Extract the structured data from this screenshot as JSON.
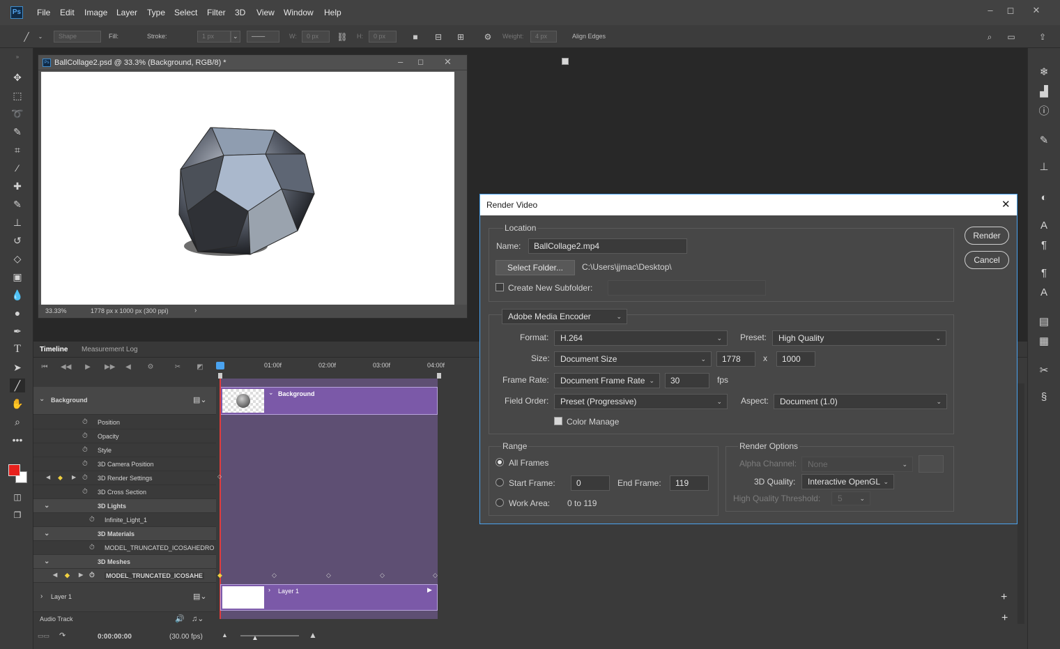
{
  "menubar": {
    "app_icon": "Ps",
    "items": [
      "File",
      "Edit",
      "Image",
      "Layer",
      "Type",
      "Select",
      "Filter",
      "3D",
      "View",
      "Window",
      "Help"
    ]
  },
  "options_bar": {
    "mode_value": "Shape",
    "fill_label": "Fill:",
    "stroke_label": "Stroke:",
    "stroke_width": "1 px",
    "w_label": "W:",
    "w_value": "0 px",
    "h_label": "H:",
    "h_value": "0 px",
    "weight_label": "Weight:",
    "weight_value": "4 px",
    "align_edges_label": "Align Edges"
  },
  "document": {
    "title": "BallCollage2.psd @ 33.3% (Background, RGB/8) *",
    "zoom": "33.33%",
    "size_info": "1778 px x 1000 px (300 ppi)"
  },
  "timeline": {
    "tabs": [
      "Timeline",
      "Measurement Log"
    ],
    "ruler_labels": [
      "01:00f",
      "02:00f",
      "03:00f",
      "04:00f"
    ],
    "background_layer": "Background",
    "rows": [
      {
        "label": "Position",
        "indent": 1
      },
      {
        "label": "Opacity",
        "indent": 1
      },
      {
        "label": "Style",
        "indent": 1
      },
      {
        "label": "3D Camera Position",
        "indent": 1
      },
      {
        "label": "3D Render Settings",
        "indent": 1
      },
      {
        "label": "3D Cross Section",
        "indent": 1
      },
      {
        "label": "3D Lights",
        "group": true
      },
      {
        "label": "Infinite_Light_1",
        "indent": 2
      },
      {
        "label": "3D Materials",
        "group": true
      },
      {
        "label": "MODEL_TRUNCATED_ICOSAHEDRO",
        "indent": 2
      },
      {
        "label": "3D Meshes",
        "group": true
      },
      {
        "label": "MODEL_TRUNCATED_ICOSAHE",
        "indent": 2
      }
    ],
    "layer1": "Layer 1",
    "clip_background": "Background",
    "clip_layer1": "Layer 1",
    "audio_track": "Audio Track",
    "timecode": "0:00:00:00",
    "fps": "(30.00 fps)"
  },
  "dialog": {
    "title": "Render Video",
    "location_label": "Location",
    "name_label": "Name:",
    "name_value": "BallCollage2.mp4",
    "select_folder": "Select Folder...",
    "folder_path": "C:\\Users\\jjmac\\Desktop\\",
    "create_subfolder": "Create New Subfolder:",
    "encoder": "Adobe Media Encoder",
    "format_label": "Format:",
    "format_value": "H.264",
    "preset_label": "Preset:",
    "preset_value": "High Quality",
    "size_label": "Size:",
    "size_value": "Document Size",
    "width": "1778",
    "x_label": "x",
    "height": "1000",
    "frame_rate_label": "Frame Rate:",
    "frame_rate_value": "Document Frame Rate",
    "fps_value": "30",
    "fps_label": "fps",
    "field_order_label": "Field Order:",
    "field_order_value": "Preset (Progressive)",
    "aspect_label": "Aspect:",
    "aspect_value": "Document (1.0)",
    "color_manage": "Color Manage",
    "range_label": "Range",
    "all_frames": "All Frames",
    "start_frame_label": "Start Frame:",
    "start_frame": "0",
    "end_frame_label": "End Frame:",
    "end_frame": "119",
    "work_area_label": "Work Area:",
    "work_area_value": "0 to 119",
    "render_options_label": "Render Options",
    "alpha_label": "Alpha Channel:",
    "alpha_value": "None",
    "quality_label": "3D Quality:",
    "quality_value": "Interactive OpenGL",
    "hq_threshold_label": "High Quality Threshold:",
    "hq_threshold_value": "5",
    "render_btn": "Render",
    "cancel_btn": "Cancel"
  },
  "colors": {
    "accent_blue": "#4aa3f0",
    "track_purple": "#7b59a8",
    "foreground": "#e8211d"
  }
}
